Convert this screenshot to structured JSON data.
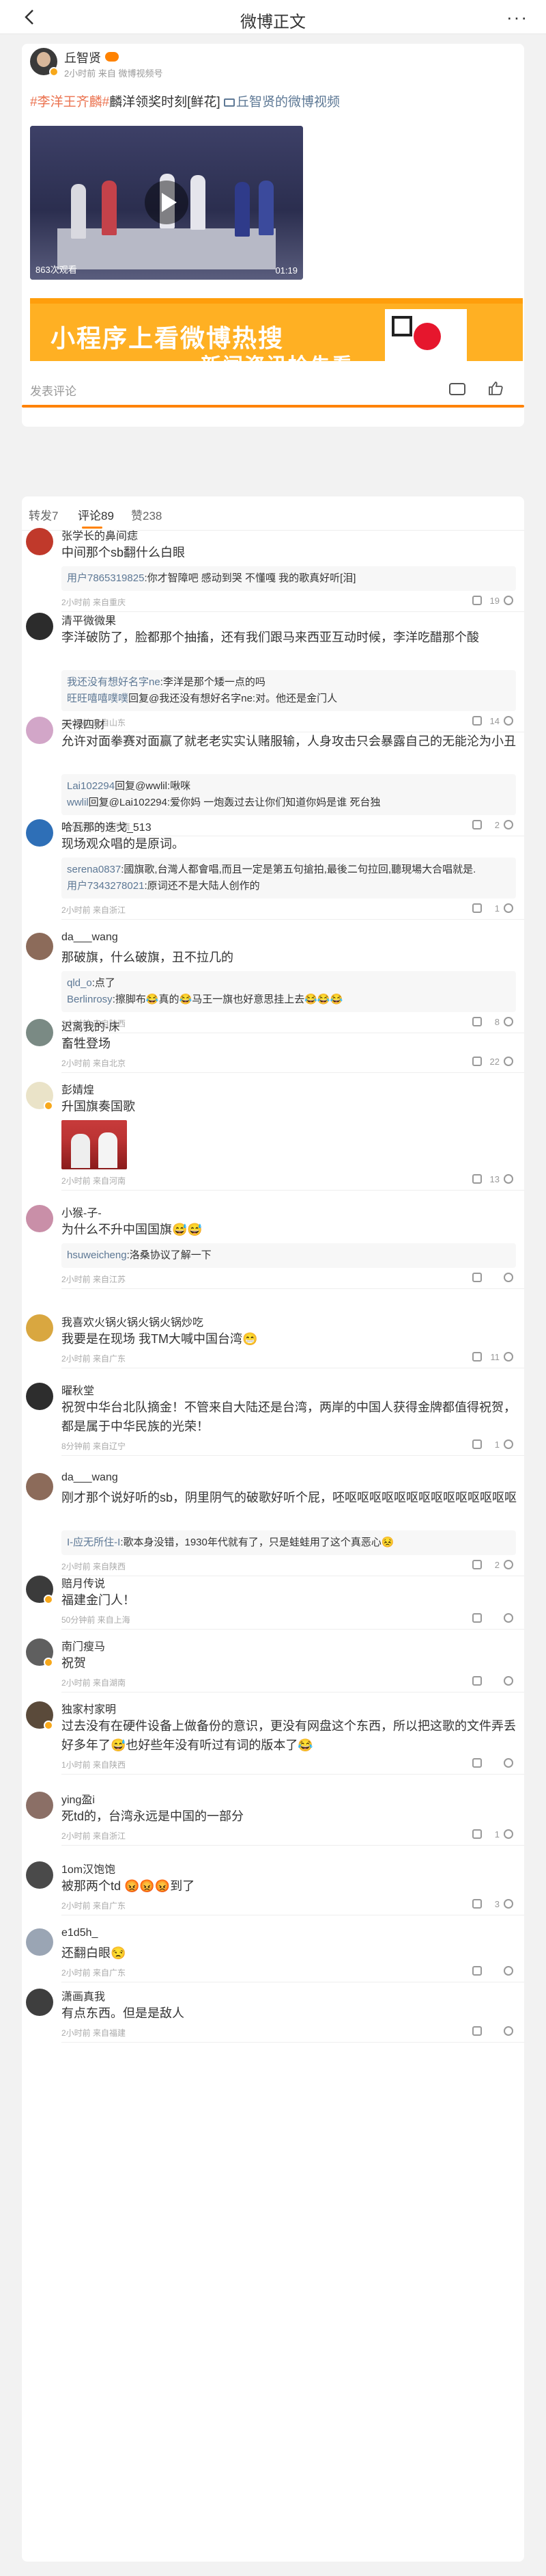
{
  "nav": {
    "title": "微博正文",
    "back_icon": "back-arrow-icon",
    "more_icon": "more-dots-icon",
    "more_label": "···"
  },
  "post": {
    "author": "丘智贤",
    "meta": "2小时前 来自 微博视频号",
    "topic": "#李洋王齐麟#",
    "text": "麟洋领奖时刻[鲜花]",
    "video_link": "丘智贤的微博视频",
    "video": {
      "views": "863次观看",
      "duration": "01:19"
    },
    "banner": {
      "line1": "小程序上看微博热搜",
      "line2": "新闻资讯抢先看"
    },
    "comment_placeholder": "发表评论",
    "accent": "#ff8200"
  },
  "tabs": {
    "repost": "转发7",
    "comment": "评论89",
    "like": "赞238"
  },
  "comments": [
    {
      "name": "张学长的鼻间痣",
      "text": "中间那个sb翻什么白眼",
      "replies": [
        {
          "user": "用户7865319825",
          "text": ":你才智障吧 感动到哭 不懂嘎 我的歌真好听[泪]"
        }
      ],
      "meta": "2小时前 来自重庆",
      "likes": "19",
      "avatar": "#c0392b",
      "badge": false
    },
    {
      "name": "清平微微果",
      "text": "李洋破防了，脸都那个抽搐，还有我们跟马来西亚互动时候，李洋吃醋那个酸",
      "replies": [
        {
          "user": "我还没有想好名字ne",
          "text": ":李洋是那个矮一点的吗"
        },
        {
          "user": "旺旺嘻嘻噗噗",
          "text": "回复@我还没有想好名字ne:对。他还是金门人"
        }
      ],
      "meta": "2小时前 来自山东",
      "likes": "14",
      "avatar": "#2c2c2c",
      "badge": false
    },
    {
      "name": "天禄四财",
      "text": "允许对面拳赛对面赢了就老老实实认赌服输，人身攻击只会暴露自己的无能沦为小丑",
      "replies": [
        {
          "user": "Lai102294",
          "text": "回复@wwlil:啾咪"
        },
        {
          "user": "wwlil",
          "text": "回复@Lai102294:爱你妈 一炮轰过去让你们知道你妈是谁 死台独"
        }
      ],
      "meta": "55分钟前 来自河南",
      "likes": "2",
      "avatar": "#d2a6c8",
      "badge": false
    },
    {
      "name": "哈瓦那的迭戈_513",
      "text": "现场观众唱的是原词。",
      "replies": [
        {
          "user": "serena0837",
          "text": ":國旗歌,台灣人都會唱,而且一定是第五句搶拍,最後二句拉回,聽現場大合唱就是."
        },
        {
          "user": "用户7343278021",
          "text": ":原词还不是大陆人创作的"
        }
      ],
      "meta": "2小时前 来自浙江",
      "likes": "1",
      "avatar": "#2e6fb7",
      "badge": false
    },
    {
      "name": "da___wang",
      "text": "那破旗，什么破旗，丑不拉几的",
      "replies": [
        {
          "user": "qld_o",
          "text": ":点了"
        },
        {
          "user": "Berlinrosy",
          "text": ":擦脚布😂真的😂马王一旗也好意思挂上去😂😂😂"
        }
      ],
      "meta": "2小时前 来自陕西",
      "likes": "8",
      "avatar": "#8c6b5a",
      "badge": false
    },
    {
      "name": "迟离我的-床",
      "text": "畜牲登场",
      "replies": [],
      "meta": "2小时前 来自北京",
      "likes": "22",
      "avatar": "#7a8a84",
      "badge": false
    },
    {
      "name": "彭婧煌",
      "text": "升国旗奏国歌",
      "replies": [],
      "meta": "2小时前 来自河南",
      "likes": "13",
      "avatar": "#eae3c8",
      "badge": true,
      "image": true
    },
    {
      "name": "小猴-子-",
      "text": "为什么不升中国国旗😅😅",
      "replies": [
        {
          "user": "hsuweicheng",
          "text": ":洛桑协议了解一下"
        }
      ],
      "meta": "2小时前 来自江苏",
      "likes": "",
      "avatar": "#c98fa8",
      "badge": false
    },
    {
      "name": "我喜欢火锅火锅火锅火锅炒吃",
      "text": "我要是在现场 我TM大喊中国台湾😁",
      "replies": [],
      "meta": "2小时前 来自广东",
      "likes": "11",
      "avatar": "#d9a740",
      "badge": false
    },
    {
      "name": "曜秋堂",
      "text": "祝贺中华台北队摘金！不管来自大陆还是台湾，两岸的中国人获得金牌都值得祝贺，都是属于中华民族的光荣！",
      "replies": [],
      "meta": "8分钟前 来自辽宁",
      "likes": "1",
      "avatar": "#2d2d2d",
      "badge": false
    },
    {
      "name": "da___wang",
      "text": "刚才那个说好听的sb，阴里阴气的破歌好听个屁，呸呕呕呕呕呕呕呕呕呕呕呕呕呕呕",
      "replies": [
        {
          "user": "I-应无所住-I",
          "text": ":歌本身没错，1930年代就有了，只是蛙蛙用了这个真恶心😣"
        }
      ],
      "meta": "2小时前 来自陕西",
      "likes": "2",
      "avatar": "#8c6b5a",
      "badge": false
    },
    {
      "name": "赔月传说",
      "text": "福建金门人！",
      "replies": [],
      "meta": "50分钟前 来自上海",
      "likes": "",
      "avatar": "#3b3b3b",
      "badge": true
    },
    {
      "name": "南门瘦马",
      "text": "祝贺",
      "replies": [],
      "meta": "2小时前 来自湖南",
      "likes": "",
      "avatar": "#5f5f5f",
      "badge": true
    },
    {
      "name": "独家村家明",
      "text": "过去没有在硬件设备上做备份的意识，更没有网盘这个东西，所以把这歌的文件弄丢好多年了😅也好些年没有听过有词的版本了😂",
      "replies": [],
      "meta": "1小时前 来自陕西",
      "likes": "",
      "avatar": "#5a4a3a",
      "badge": true
    },
    {
      "name": "ying盈i",
      "text": "死td的，台湾永远是中国的一部分",
      "replies": [],
      "meta": "2小时前 来自浙江",
      "likes": "1",
      "avatar": "#8b6f66",
      "badge": false
    },
    {
      "name": "1om汉饱饱",
      "text": "被那两个td 😡😡😡到了",
      "replies": [],
      "meta": "2小时前 来自广东",
      "likes": "3",
      "avatar": "#4a4a4a",
      "badge": false
    },
    {
      "name": "e1d5h_",
      "text": "还翻白眼😒",
      "replies": [],
      "meta": "2小时前 来自广东",
      "likes": "",
      "avatar": "#9aa5b4",
      "badge": false
    },
    {
      "name": "潇画真我",
      "text": "有点东西。但是是敌人",
      "replies": [],
      "meta": "2小时前 来自福建",
      "likes": "",
      "avatar": "#3e3e3e",
      "badge": false
    }
  ]
}
